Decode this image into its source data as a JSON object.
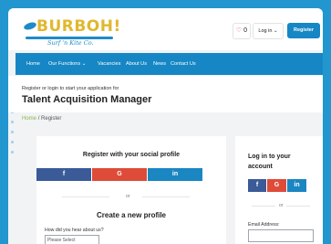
{
  "brand": {
    "name": "BURBOH!",
    "tagline": "Surf 'n Kite Co."
  },
  "header": {
    "favourites_icon": "heart-icon",
    "favourites_count": "0",
    "login_label": "Log in",
    "register_label": "Register"
  },
  "nav": {
    "items": [
      "Home",
      "Our Functions",
      "Vacancies",
      "About Us",
      "News",
      "Contact Us"
    ]
  },
  "intro": {
    "subtitle": "Register or login to start your application for",
    "title": "Talent Acquisition Manager"
  },
  "breadcrumb": {
    "home": "Home",
    "current": "Register"
  },
  "register": {
    "social_heading": "Register with your social profile",
    "or_text": "or",
    "create_heading": "Create a new profile",
    "hear_label": "How did you hear about us?",
    "hear_value": "Please Select"
  },
  "login": {
    "heading": "Log in to your account",
    "or_text": "or",
    "email_label": "Email Address:",
    "email_value": ""
  },
  "social": {
    "facebook": "f",
    "google": "G",
    "linkedin": "in"
  },
  "colors": {
    "brand_blue": "#1687c4",
    "brand_yellow": "#e0b82f",
    "facebook": "#3a5a98",
    "google": "#de4b39",
    "linkedin": "#1a86c2",
    "backdrop": "#2196cf"
  }
}
